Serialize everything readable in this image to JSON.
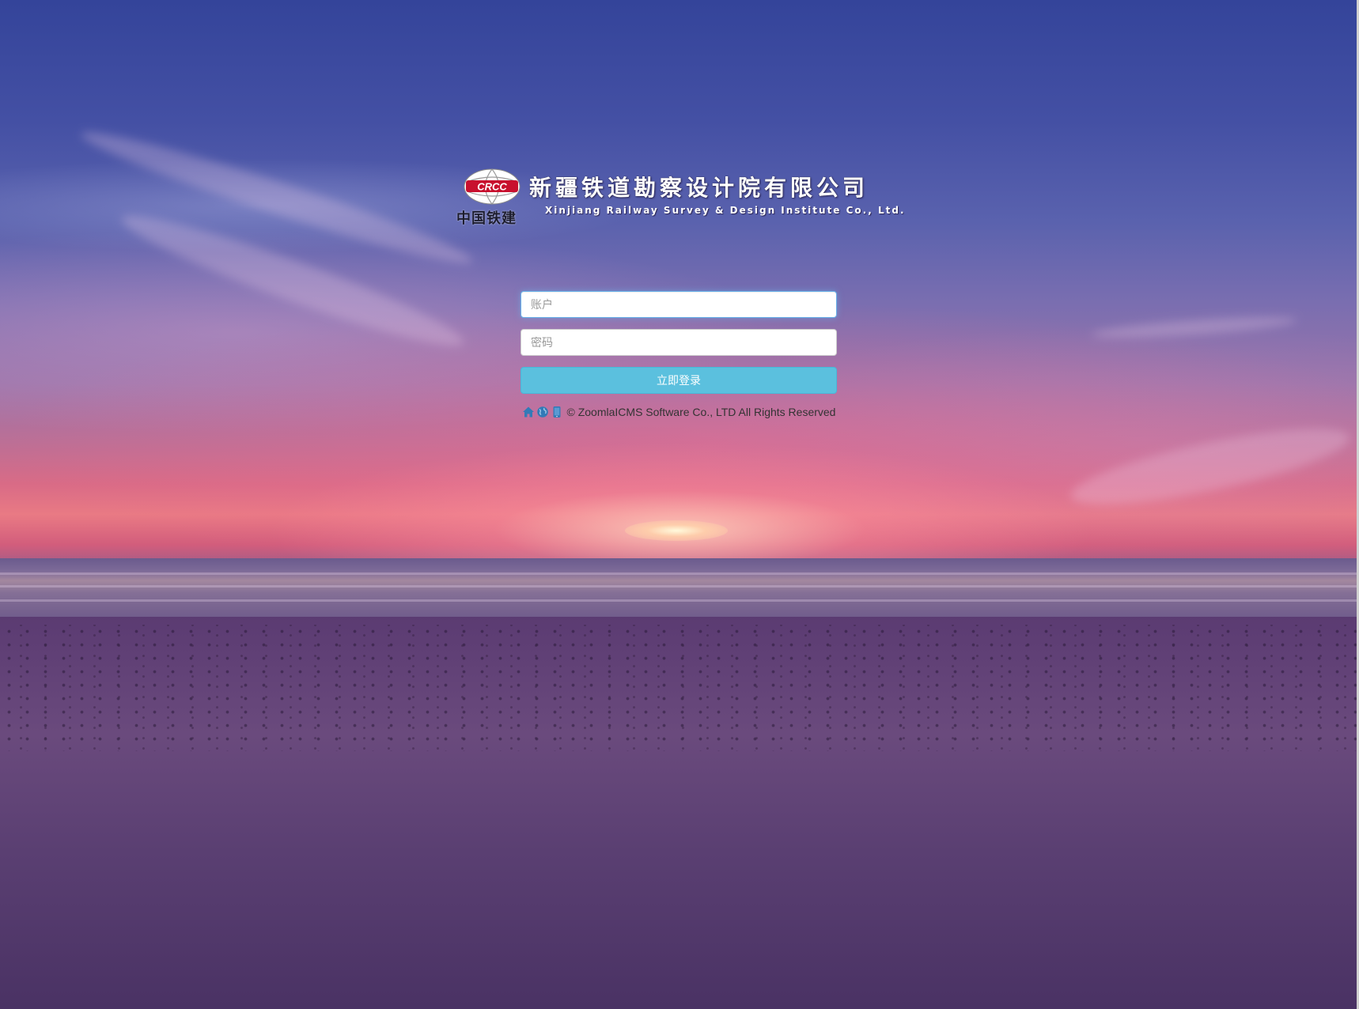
{
  "logo": {
    "emblem_text": "CRCC",
    "brand_cn": "中国铁建",
    "company_cn": "新疆铁道勘察设计院有限公司",
    "company_en": "Xinjiang Railway Survey & Design Institute Co., Ltd."
  },
  "login": {
    "account_placeholder": "账户",
    "account_value": "",
    "password_placeholder": "密码",
    "password_value": "",
    "submit_label": "立即登录"
  },
  "footer": {
    "icons": [
      "home-icon",
      "globe-icon",
      "mobile-icon"
    ],
    "copyright": "© ZoomlaICMS Software Co., LTD All Rights Reserved"
  },
  "colors": {
    "submit_button": "#5bc0de",
    "icon_blue": "#337ab7",
    "emblem_red": "#c8102e"
  }
}
